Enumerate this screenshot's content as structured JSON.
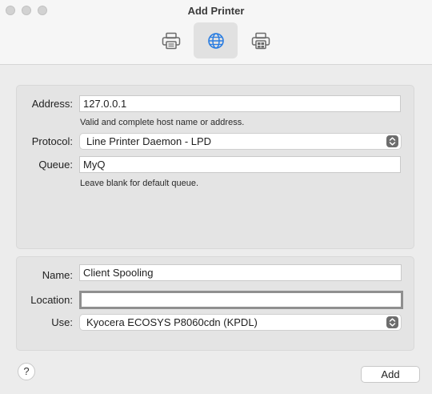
{
  "window": {
    "title": "Add Printer"
  },
  "toolbar": {
    "tabs": [
      {
        "icon": "printer-icon",
        "active": false
      },
      {
        "icon": "globe-icon",
        "active": true
      },
      {
        "icon": "windows-printer-icon",
        "active": false
      }
    ]
  },
  "ip_group": {
    "address_label": "Address:",
    "address_value": "127.0.0.1",
    "address_hint": "Valid and complete host name or address.",
    "protocol_label": "Protocol:",
    "protocol_value": "Line Printer Daemon - LPD",
    "queue_label": "Queue:",
    "queue_value": "MyQ",
    "queue_hint": "Leave blank for default queue."
  },
  "printer_group": {
    "name_label": "Name:",
    "name_value": "Client Spooling",
    "location_label": "Location:",
    "location_value": "",
    "use_label": "Use:",
    "use_value": "Kyocera ECOSYS P8060cdn (KPDL)"
  },
  "footer": {
    "help_label": "?",
    "add_label": "Add"
  },
  "colors": {
    "accent": "#2a7de1",
    "window_bg": "#ececec"
  }
}
